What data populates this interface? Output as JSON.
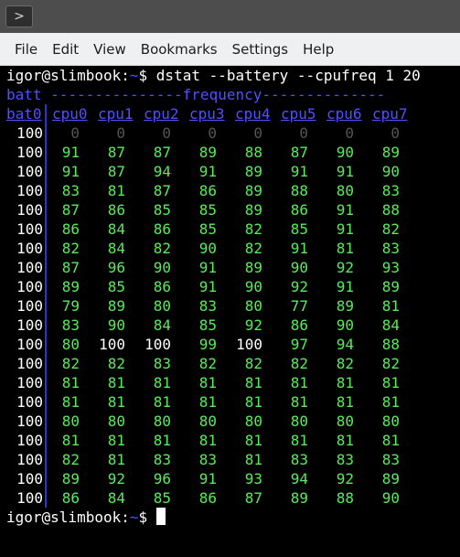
{
  "window": {
    "menu": [
      "File",
      "Edit",
      "View",
      "Bookmarks",
      "Settings",
      "Help"
    ]
  },
  "terminal": {
    "prompt_user": "igor@slimbook",
    "prompt_sep": ":",
    "prompt_path": "~",
    "prompt_symbol": "$",
    "command": "dstat --battery --cpufreq 1 20",
    "group_header_batt": "batt",
    "group_header_freq": "---------------frequency--------------",
    "group_header_batt_dash": " ",
    "columns": [
      "bat0",
      "cpu0",
      "cpu1",
      "cpu2",
      "cpu3",
      "cpu4",
      "cpu5",
      "cpu6",
      "cpu7"
    ],
    "rows": [
      [
        "100",
        "0",
        "0",
        "0",
        "0",
        "0",
        "0",
        "0",
        "0"
      ],
      [
        "100",
        "91",
        "87",
        "87",
        "89",
        "88",
        "87",
        "90",
        "89"
      ],
      [
        "100",
        "91",
        "87",
        "94",
        "91",
        "89",
        "91",
        "91",
        "90"
      ],
      [
        "100",
        "83",
        "81",
        "87",
        "86",
        "89",
        "88",
        "80",
        "83"
      ],
      [
        "100",
        "87",
        "86",
        "85",
        "85",
        "89",
        "86",
        "91",
        "88"
      ],
      [
        "100",
        "86",
        "84",
        "86",
        "85",
        "82",
        "85",
        "91",
        "82"
      ],
      [
        "100",
        "82",
        "84",
        "82",
        "90",
        "82",
        "91",
        "81",
        "83"
      ],
      [
        "100",
        "87",
        "96",
        "90",
        "91",
        "89",
        "90",
        "92",
        "93"
      ],
      [
        "100",
        "89",
        "85",
        "86",
        "91",
        "90",
        "92",
        "91",
        "89"
      ],
      [
        "100",
        "79",
        "89",
        "80",
        "83",
        "80",
        "77",
        "89",
        "81"
      ],
      [
        "100",
        "83",
        "90",
        "84",
        "85",
        "92",
        "86",
        "90",
        "84"
      ],
      [
        "100",
        "80",
        "100",
        "100",
        "99",
        "100",
        "97",
        "94",
        "88"
      ],
      [
        "100",
        "82",
        "82",
        "83",
        "82",
        "82",
        "82",
        "82",
        "82"
      ],
      [
        "100",
        "81",
        "81",
        "81",
        "81",
        "81",
        "81",
        "81",
        "81"
      ],
      [
        "100",
        "81",
        "81",
        "81",
        "81",
        "81",
        "81",
        "81",
        "81"
      ],
      [
        "100",
        "80",
        "80",
        "80",
        "80",
        "80",
        "80",
        "80",
        "80"
      ],
      [
        "100",
        "81",
        "81",
        "81",
        "81",
        "81",
        "81",
        "81",
        "81"
      ],
      [
        "100",
        "82",
        "81",
        "83",
        "83",
        "81",
        "83",
        "83",
        "83"
      ],
      [
        "100",
        "89",
        "92",
        "96",
        "91",
        "93",
        "94",
        "92",
        "89"
      ],
      [
        "100",
        "86",
        "84",
        "85",
        "86",
        "87",
        "89",
        "88",
        "90"
      ]
    ]
  },
  "colors": {
    "prompt": "#ffffff",
    "header": "#5050ff",
    "value": "#55ee55",
    "max_value": "#ffffff",
    "zero_value": "#555555"
  },
  "icons": {
    "terminal_button": "terminal-icon"
  }
}
